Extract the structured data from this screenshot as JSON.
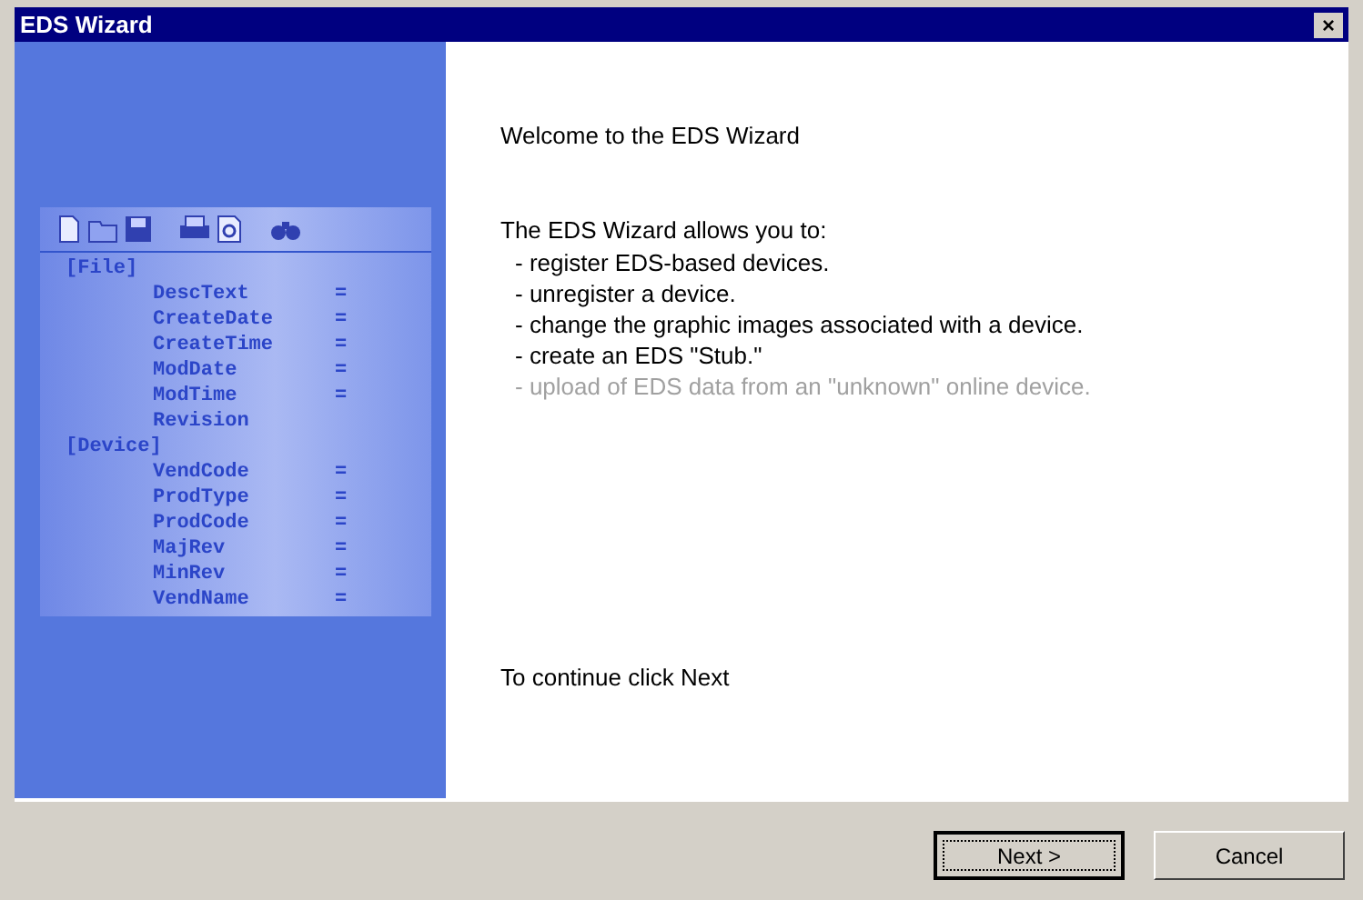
{
  "window": {
    "title": "EDS Wizard",
    "close": "×"
  },
  "editor": {
    "sections": [
      {
        "header": "[File]",
        "entries": [
          {
            "key": "DescText",
            "separator": "="
          },
          {
            "key": "CreateDate",
            "separator": "="
          },
          {
            "key": "CreateTime",
            "separator": "="
          },
          {
            "key": "ModDate",
            "separator": "="
          },
          {
            "key": "ModTime",
            "separator": "="
          },
          {
            "key": "Revision"
          }
        ]
      },
      {
        "header": "[Device]",
        "entries": [
          {
            "key": "VendCode",
            "separator": "="
          },
          {
            "key": "ProdType",
            "separator": "="
          },
          {
            "key": "ProdCode",
            "separator": "="
          },
          {
            "key": "MajRev",
            "separator": "="
          },
          {
            "key": "MinRev",
            "separator": "="
          },
          {
            "key": "VendName",
            "separator": "="
          }
        ]
      }
    ]
  },
  "content": {
    "heading": "Welcome to the EDS Wizard",
    "intro": "The EDS Wizard allows you to:",
    "items": [
      {
        "text": "- register EDS-based devices.",
        "disabled": false
      },
      {
        "text": "- unregister a device.",
        "disabled": false
      },
      {
        "text": "- change the graphic images associated with a device.",
        "disabled": false
      },
      {
        "text": "- create an EDS \"Stub.\"",
        "disabled": false
      },
      {
        "text": "- upload of EDS data from an \"unknown\" online device.",
        "disabled": true
      }
    ],
    "footer": "To continue click Next"
  },
  "buttons": [
    {
      "label": "Next >",
      "focused": true
    },
    {
      "label": "Cancel",
      "focused": false
    }
  ]
}
